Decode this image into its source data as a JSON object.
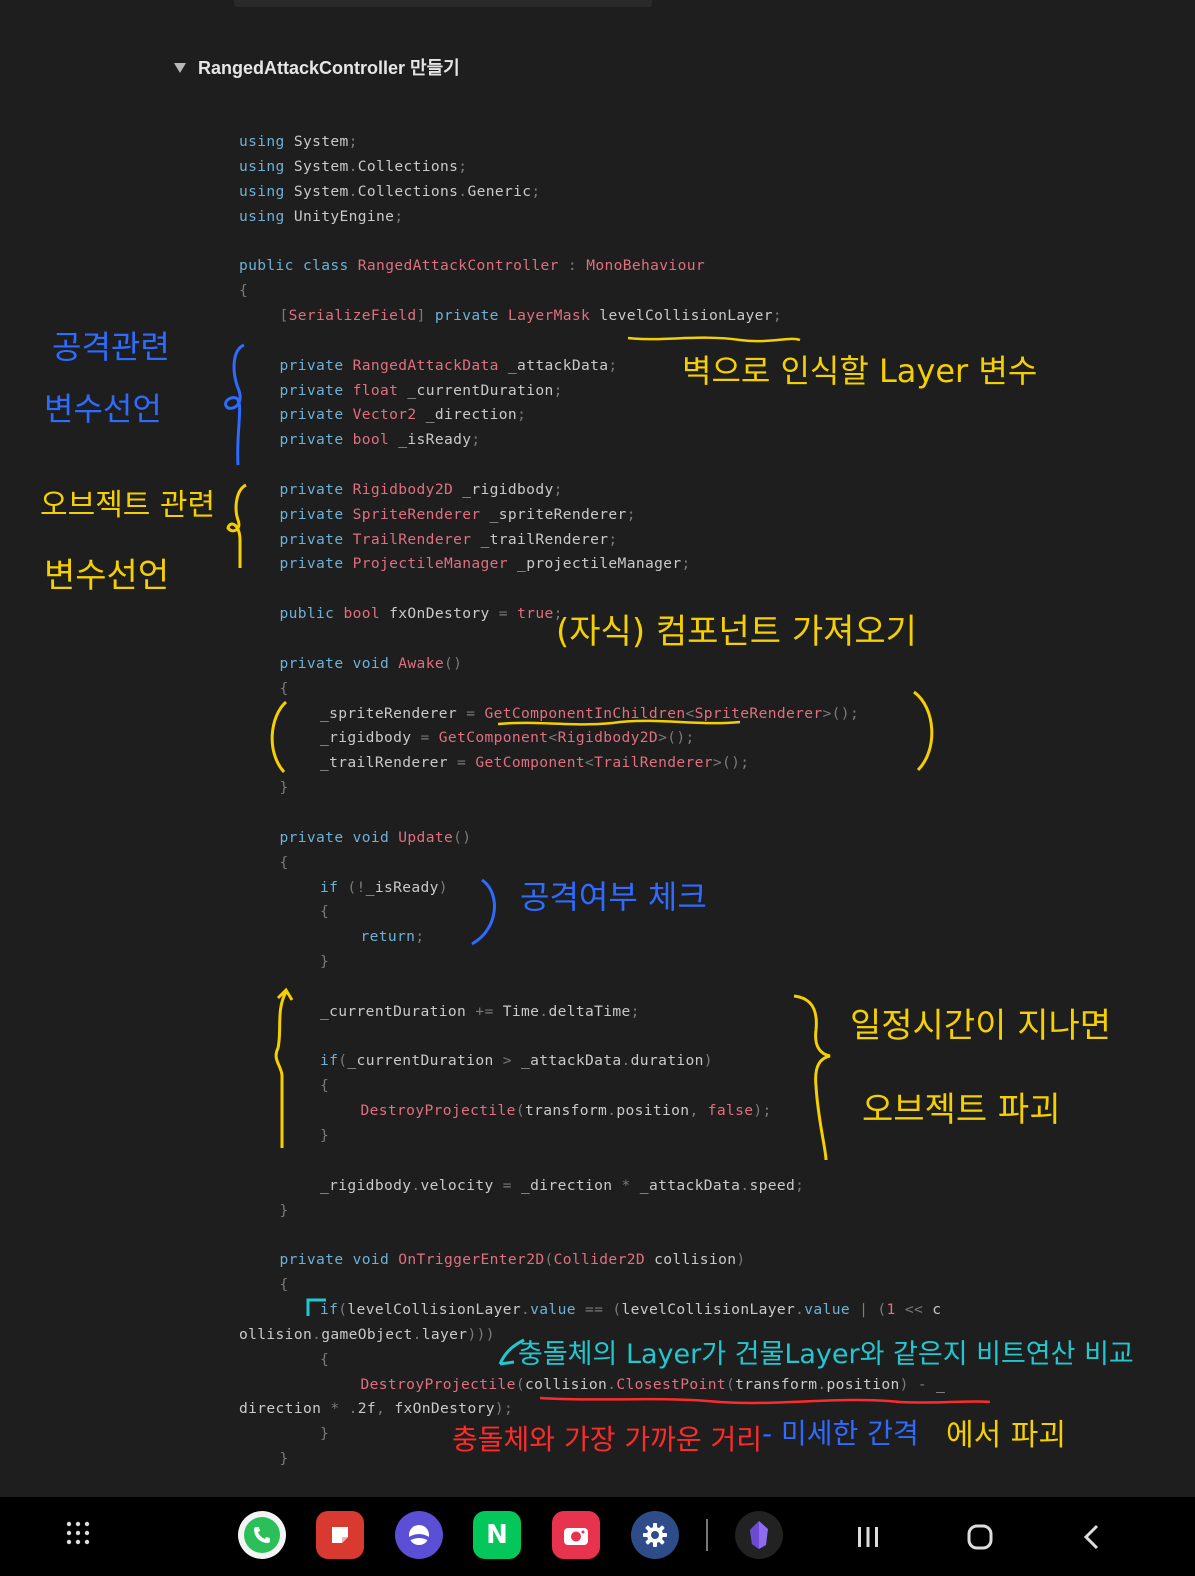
{
  "toggle": {
    "title": "RangedAttackController 만들기"
  },
  "code_lines": [
    {
      "indent": 0,
      "parts": [
        [
          "kw",
          "using"
        ],
        [
          "n",
          " System"
        ],
        [
          "pu",
          ";"
        ]
      ]
    },
    {
      "indent": 0,
      "parts": [
        [
          "kw",
          "using"
        ],
        [
          "n",
          " System"
        ],
        [
          "pu",
          "."
        ],
        [
          "n",
          "Collections"
        ],
        [
          "pu",
          ";"
        ]
      ]
    },
    {
      "indent": 0,
      "parts": [
        [
          "kw",
          "using"
        ],
        [
          "n",
          " System"
        ],
        [
          "pu",
          "."
        ],
        [
          "n",
          "Collections"
        ],
        [
          "pu",
          "."
        ],
        [
          "n",
          "Generic"
        ],
        [
          "pu",
          ";"
        ]
      ]
    },
    {
      "indent": 0,
      "parts": [
        [
          "kw",
          "using"
        ],
        [
          "n",
          " UnityEngine"
        ],
        [
          "pu",
          ";"
        ]
      ]
    },
    {
      "indent": 0,
      "parts": []
    },
    {
      "indent": 0,
      "parts": [
        [
          "kw",
          "public class "
        ],
        [
          "ty",
          "RangedAttackController"
        ],
        [
          "n",
          " "
        ],
        [
          "pu",
          ":"
        ],
        [
          "n",
          " "
        ],
        [
          "ty",
          "MonoBehaviour"
        ]
      ]
    },
    {
      "indent": 0,
      "parts": [
        [
          "pu",
          "{"
        ]
      ]
    },
    {
      "indent": 1,
      "parts": [
        [
          "pu",
          "["
        ],
        [
          "ty",
          "SerializeField"
        ],
        [
          "pu",
          "]"
        ],
        [
          "n",
          " "
        ],
        [
          "kw",
          "private "
        ],
        [
          "ty",
          "LayerMask"
        ],
        [
          "n",
          " levelCollisionLayer"
        ],
        [
          "pu",
          ";"
        ]
      ]
    },
    {
      "indent": 0,
      "parts": []
    },
    {
      "indent": 1,
      "parts": [
        [
          "kw",
          "private "
        ],
        [
          "ty",
          "RangedAttackData"
        ],
        [
          "n",
          " _attackData"
        ],
        [
          "pu",
          ";"
        ]
      ]
    },
    {
      "indent": 1,
      "parts": [
        [
          "kw",
          "private "
        ],
        [
          "ty",
          "float"
        ],
        [
          "n",
          " _currentDuration"
        ],
        [
          "pu",
          ";"
        ]
      ]
    },
    {
      "indent": 1,
      "parts": [
        [
          "kw",
          "private "
        ],
        [
          "ty",
          "Vector2"
        ],
        [
          "n",
          " _direction"
        ],
        [
          "pu",
          ";"
        ]
      ]
    },
    {
      "indent": 1,
      "parts": [
        [
          "kw",
          "private "
        ],
        [
          "ty",
          "bool"
        ],
        [
          "n",
          " _isReady"
        ],
        [
          "pu",
          ";"
        ]
      ]
    },
    {
      "indent": 0,
      "parts": []
    },
    {
      "indent": 1,
      "parts": [
        [
          "kw",
          "private "
        ],
        [
          "ty",
          "Rigidbody2D"
        ],
        [
          "n",
          " _rigidbody"
        ],
        [
          "pu",
          ";"
        ]
      ]
    },
    {
      "indent": 1,
      "parts": [
        [
          "kw",
          "private "
        ],
        [
          "ty",
          "SpriteRenderer"
        ],
        [
          "n",
          " _spriteRenderer"
        ],
        [
          "pu",
          ";"
        ]
      ]
    },
    {
      "indent": 1,
      "parts": [
        [
          "kw",
          "private "
        ],
        [
          "ty",
          "TrailRenderer"
        ],
        [
          "n",
          " _trailRenderer"
        ],
        [
          "pu",
          ";"
        ]
      ]
    },
    {
      "indent": 1,
      "parts": [
        [
          "kw",
          "private "
        ],
        [
          "ty",
          "ProjectileManager"
        ],
        [
          "n",
          " _projectileManager"
        ],
        [
          "pu",
          ";"
        ]
      ]
    },
    {
      "indent": 0,
      "parts": []
    },
    {
      "indent": 1,
      "parts": [
        [
          "kw",
          "public "
        ],
        [
          "ty",
          "bool"
        ],
        [
          "n",
          " fxOnDestory "
        ],
        [
          "pu",
          "="
        ],
        [
          "n",
          " "
        ],
        [
          "bo",
          "true"
        ],
        [
          "pu",
          ";"
        ]
      ]
    },
    {
      "indent": 0,
      "parts": []
    },
    {
      "indent": 1,
      "parts": [
        [
          "kw",
          "private void "
        ],
        [
          "ty",
          "Awake"
        ],
        [
          "pu",
          "()"
        ]
      ]
    },
    {
      "indent": 1,
      "parts": [
        [
          "pu",
          "{"
        ]
      ]
    },
    {
      "indent": 2,
      "parts": [
        [
          "n",
          "_spriteRenderer "
        ],
        [
          "pu",
          "="
        ],
        [
          "n",
          " "
        ],
        [
          "ty",
          "GetComponentInChildren"
        ],
        [
          "pu",
          "<"
        ],
        [
          "ty",
          "SpriteRenderer"
        ],
        [
          "pu",
          ">();"
        ]
      ]
    },
    {
      "indent": 2,
      "parts": [
        [
          "n",
          "_rigidbody "
        ],
        [
          "pu",
          "="
        ],
        [
          "n",
          " "
        ],
        [
          "ty",
          "GetComponent"
        ],
        [
          "pu",
          "<"
        ],
        [
          "ty",
          "Rigidbody2D"
        ],
        [
          "pu",
          ">();"
        ]
      ]
    },
    {
      "indent": 2,
      "parts": [
        [
          "n",
          "_trailRenderer "
        ],
        [
          "pu",
          "="
        ],
        [
          "n",
          " "
        ],
        [
          "ty",
          "GetComponent"
        ],
        [
          "pu",
          "<"
        ],
        [
          "ty",
          "TrailRenderer"
        ],
        [
          "pu",
          ">();"
        ]
      ]
    },
    {
      "indent": 1,
      "parts": [
        [
          "pu",
          "}"
        ]
      ]
    },
    {
      "indent": 0,
      "parts": []
    },
    {
      "indent": 1,
      "parts": [
        [
          "kw",
          "private void "
        ],
        [
          "ty",
          "Update"
        ],
        [
          "pu",
          "()"
        ]
      ]
    },
    {
      "indent": 1,
      "parts": [
        [
          "pu",
          "{"
        ]
      ]
    },
    {
      "indent": 2,
      "parts": [
        [
          "kw",
          "if"
        ],
        [
          "n",
          " "
        ],
        [
          "pu",
          "(!"
        ],
        [
          "n",
          "_isReady"
        ],
        [
          "pu",
          ")"
        ]
      ]
    },
    {
      "indent": 2,
      "parts": [
        [
          "pu",
          "{"
        ]
      ]
    },
    {
      "indent": 3,
      "parts": [
        [
          "kw",
          "return"
        ],
        [
          "pu",
          ";"
        ]
      ]
    },
    {
      "indent": 2,
      "parts": [
        [
          "pu",
          "}"
        ]
      ]
    },
    {
      "indent": 0,
      "parts": []
    },
    {
      "indent": 2,
      "parts": [
        [
          "n",
          "_currentDuration "
        ],
        [
          "pu",
          "+="
        ],
        [
          "n",
          " Time"
        ],
        [
          "pu",
          "."
        ],
        [
          "n",
          "deltaTime"
        ],
        [
          "pu",
          ";"
        ]
      ]
    },
    {
      "indent": 0,
      "parts": []
    },
    {
      "indent": 2,
      "parts": [
        [
          "kw",
          "if"
        ],
        [
          "pu",
          "("
        ],
        [
          "n",
          "_currentDuration "
        ],
        [
          "pu",
          ">"
        ],
        [
          "n",
          " _attackData"
        ],
        [
          "pu",
          "."
        ],
        [
          "n",
          "duration"
        ],
        [
          "pu",
          ")"
        ]
      ]
    },
    {
      "indent": 2,
      "parts": [
        [
          "pu",
          "{"
        ]
      ]
    },
    {
      "indent": 3,
      "parts": [
        [
          "ty",
          "DestroyProjectile"
        ],
        [
          "pu",
          "("
        ],
        [
          "n",
          "transform"
        ],
        [
          "pu",
          "."
        ],
        [
          "n",
          "position"
        ],
        [
          "pu",
          ","
        ],
        [
          "n",
          " "
        ],
        [
          "bo",
          "false"
        ],
        [
          "pu",
          ");"
        ]
      ]
    },
    {
      "indent": 2,
      "parts": [
        [
          "pu",
          "}"
        ]
      ]
    },
    {
      "indent": 0,
      "parts": []
    },
    {
      "indent": 2,
      "parts": [
        [
          "n",
          "_rigidbody"
        ],
        [
          "pu",
          "."
        ],
        [
          "n",
          "velocity "
        ],
        [
          "pu",
          "="
        ],
        [
          "n",
          " _direction "
        ],
        [
          "pu",
          "*"
        ],
        [
          "n",
          " _attackData"
        ],
        [
          "pu",
          "."
        ],
        [
          "n",
          "speed"
        ],
        [
          "pu",
          ";"
        ]
      ]
    },
    {
      "indent": 1,
      "parts": [
        [
          "pu",
          "}"
        ]
      ]
    },
    {
      "indent": 0,
      "parts": []
    },
    {
      "indent": 1,
      "parts": [
        [
          "kw",
          "private void "
        ],
        [
          "ty",
          "OnTriggerEnter2D"
        ],
        [
          "pu",
          "("
        ],
        [
          "ty",
          "Collider2D"
        ],
        [
          "n",
          " collision"
        ],
        [
          "pu",
          ")"
        ]
      ]
    },
    {
      "indent": 1,
      "parts": [
        [
          "pu",
          "{"
        ]
      ]
    },
    {
      "indent": 2,
      "parts": [
        [
          "kw",
          "if"
        ],
        [
          "pu",
          "("
        ],
        [
          "n",
          "levelCollisionLayer"
        ],
        [
          "pu",
          "."
        ],
        [
          "kw",
          "value"
        ],
        [
          "n",
          " "
        ],
        [
          "pu",
          "=="
        ],
        [
          "n",
          " "
        ],
        [
          "pu",
          "("
        ],
        [
          "n",
          "levelCollisionLayer"
        ],
        [
          "pu",
          "."
        ],
        [
          "kw",
          "value"
        ],
        [
          "n",
          " "
        ],
        [
          "pu",
          "|"
        ],
        [
          "n",
          " "
        ],
        [
          "pu",
          "("
        ],
        [
          "ty",
          "1"
        ],
        [
          "n",
          " "
        ],
        [
          "pu",
          "<<"
        ],
        [
          "n",
          " c"
        ]
      ]
    },
    {
      "indent": 0,
      "parts": [
        [
          "n",
          "ollision"
        ],
        [
          "pu",
          "."
        ],
        [
          "n",
          "gameObject"
        ],
        [
          "pu",
          "."
        ],
        [
          "n",
          "layer"
        ],
        [
          "pu",
          ")))"
        ]
      ]
    },
    {
      "indent": 2,
      "parts": [
        [
          "pu",
          "{"
        ]
      ]
    },
    {
      "indent": 3,
      "parts": [
        [
          "ty",
          "DestroyProjectile"
        ],
        [
          "pu",
          "("
        ],
        [
          "n",
          "collision"
        ],
        [
          "pu",
          "."
        ],
        [
          "ty",
          "ClosestPoint"
        ],
        [
          "pu",
          "("
        ],
        [
          "n",
          "transform"
        ],
        [
          "pu",
          "."
        ],
        [
          "n",
          "position"
        ],
        [
          "pu",
          ")"
        ],
        [
          "n",
          " "
        ],
        [
          "pu",
          "-"
        ],
        [
          "n",
          " _"
        ]
      ]
    },
    {
      "indent": 0,
      "parts": [
        [
          "n",
          "direction "
        ],
        [
          "pu",
          "*"
        ],
        [
          "n",
          " "
        ],
        [
          "pu",
          "."
        ],
        [
          "n",
          "2f"
        ],
        [
          "pu",
          ","
        ],
        [
          "n",
          " fxOnDestory"
        ],
        [
          "pu",
          ");"
        ]
      ]
    },
    {
      "indent": 2,
      "parts": [
        [
          "pu",
          "}"
        ]
      ]
    },
    {
      "indent": 1,
      "parts": [
        [
          "pu",
          "}"
        ]
      ]
    }
  ],
  "annotations": {
    "attack_vars_l1": "공격관련",
    "attack_vars_l2": "변수선언",
    "object_vars_l1": "오브젝트 관련",
    "object_vars_l2": "변수선언",
    "wall_layer": "벽으로 인식할  Layer 변수",
    "child_component": "(자식) 컴포넌트 가져오기",
    "ready_check": "공격여부 체크",
    "timeout_l1": "일정시간이 지나면",
    "timeout_l2": "오브젝트 파괴",
    "layer_compare": "충돌체의 Layer가 건물Layer와 같은지 비트연산 비교",
    "closest_red": "충돌체와 가장 가까운 거리",
    "closest_blue": "- 미세한 간격",
    "closest_end": "에서 파괴"
  },
  "colors": {
    "keyword": "#6cb1d6",
    "type": "#e06f7f",
    "ink_blue": "#2f6bff",
    "ink_yellow": "#f5d000",
    "ink_cyan": "#22c7cf",
    "ink_red": "#ff2a2a"
  },
  "dock": {
    "apps": [
      "apps-grid-icon",
      "phone-icon",
      "notes-icon",
      "internet-icon",
      "naver-icon",
      "camera-icon",
      "settings-icon",
      "obsidian-icon"
    ],
    "nav": [
      "recent-apps-icon",
      "home-icon",
      "back-icon"
    ]
  }
}
